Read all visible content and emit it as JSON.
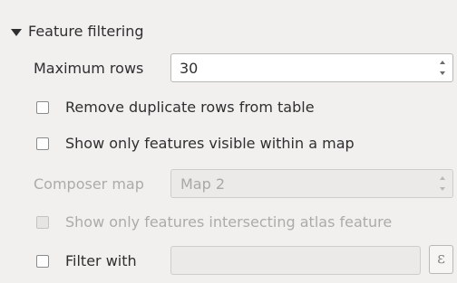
{
  "section": {
    "title": "Feature filtering"
  },
  "maximum_rows": {
    "label": "Maximum rows",
    "value": "30"
  },
  "remove_duplicates": {
    "label": "Remove duplicate rows from table",
    "checked": false
  },
  "visible_in_map": {
    "label": "Show only features visible within a map",
    "checked": false
  },
  "composer_map": {
    "label": "Composer map",
    "selected": "Map 2",
    "enabled": false
  },
  "atlas_intersect": {
    "label": "Show only features intersecting atlas feature",
    "checked": false,
    "enabled": false
  },
  "filter_with": {
    "label": "Filter with",
    "checked": false,
    "value": "",
    "expression_button": "ε"
  },
  "icons": {
    "collapse": "triangle-down-icon",
    "spin_arrows": "spin-arrows-icon",
    "expression": "epsilon-icon"
  },
  "colors": {
    "panel_bg": "#f1f0ef",
    "text": "#2f2f2f",
    "disabled_text": "#acaba9"
  }
}
